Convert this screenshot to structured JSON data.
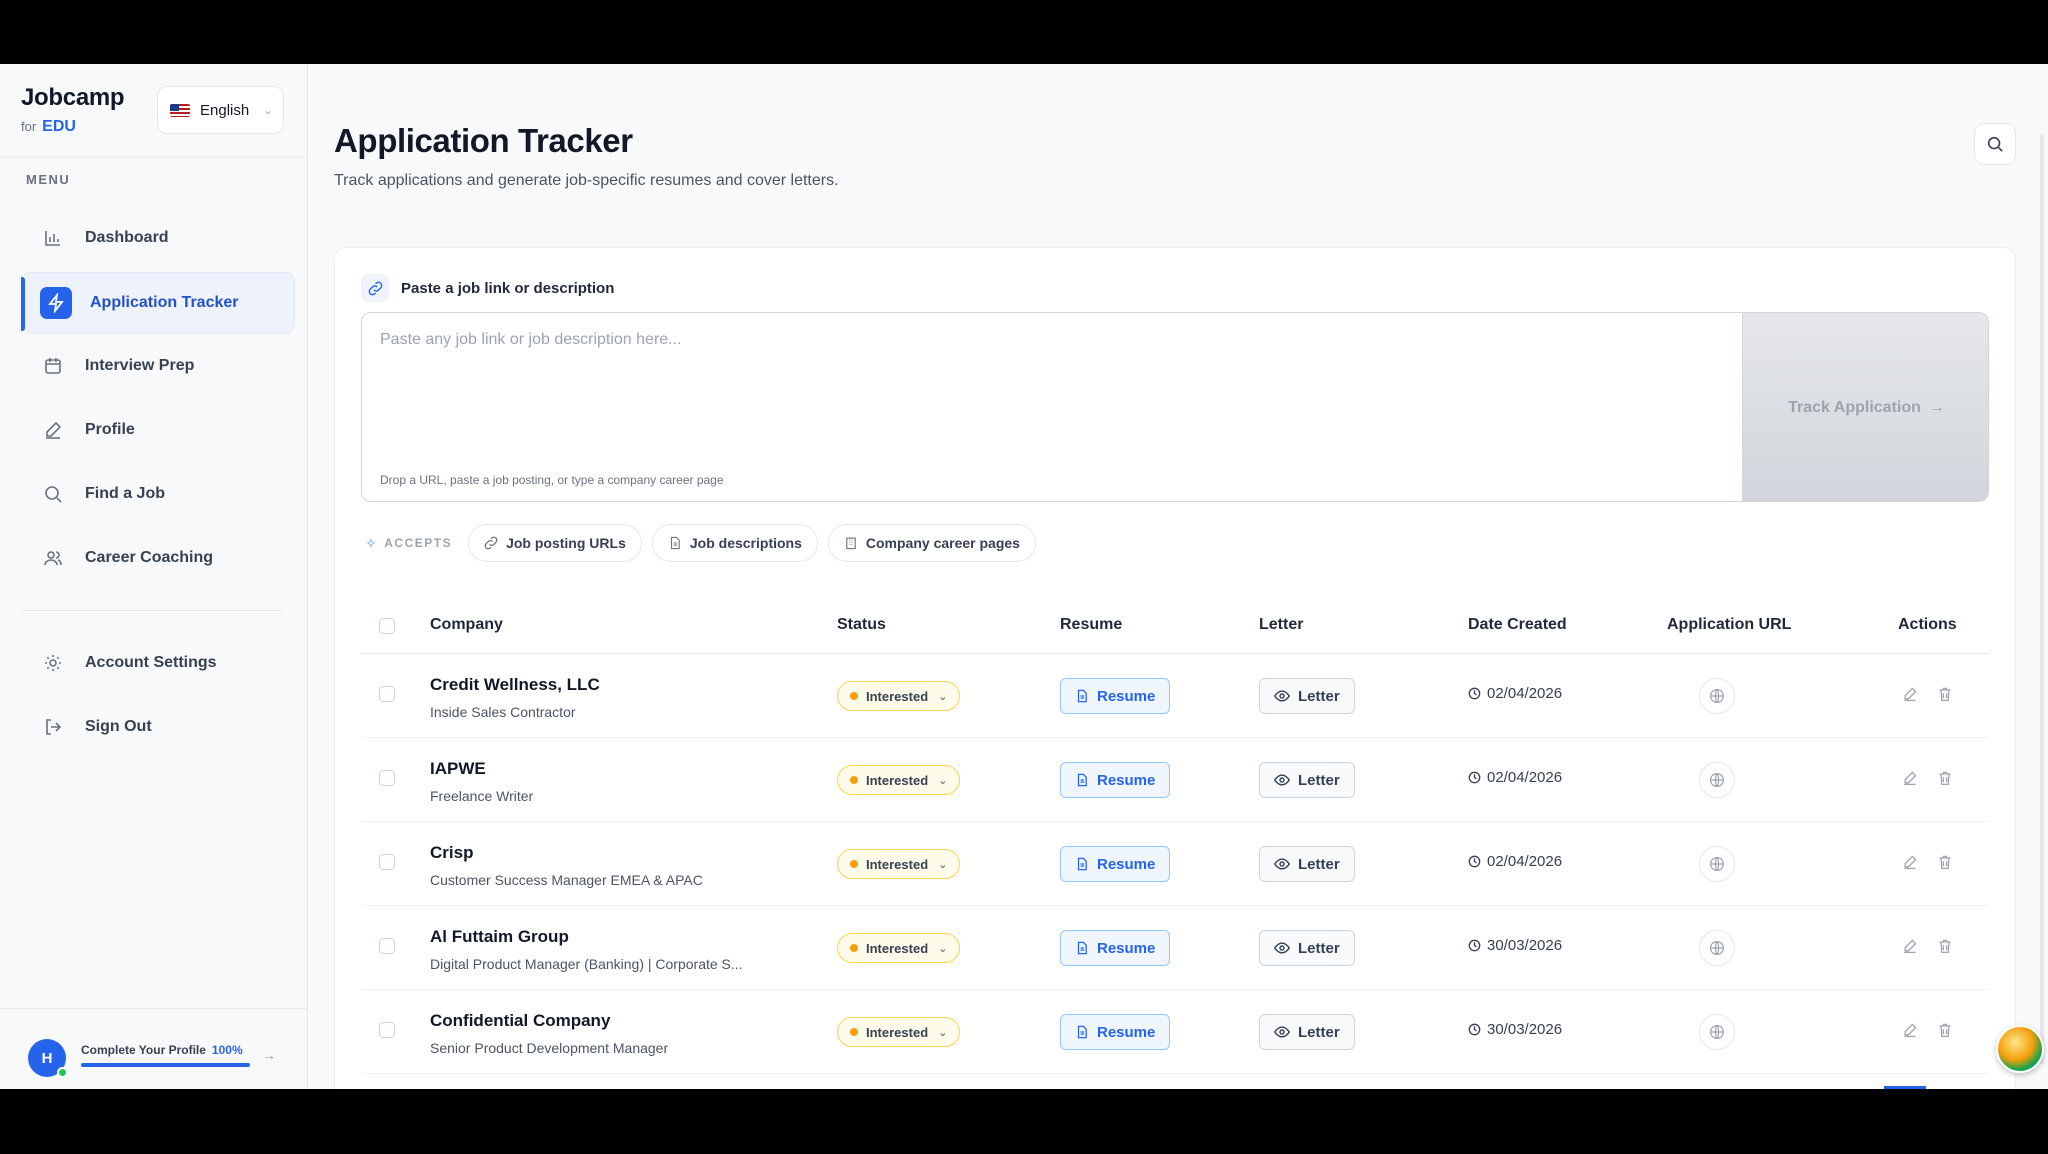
{
  "brand": {
    "name": "Jobcamp",
    "for_label": "for",
    "edu_label": "EDU"
  },
  "language": {
    "label": "English"
  },
  "menu_title": "MENU",
  "nav": [
    {
      "label": "Dashboard",
      "icon": "bar-chart-icon"
    },
    {
      "label": "Application Tracker",
      "icon": "lightning-icon",
      "active": true
    },
    {
      "label": "Interview Prep",
      "icon": "calendar-icon"
    },
    {
      "label": "Profile",
      "icon": "pencil-icon"
    },
    {
      "label": "Find a Job",
      "icon": "search-icon"
    },
    {
      "label": "Career Coaching",
      "icon": "users-icon"
    }
  ],
  "nav_secondary": [
    {
      "label": "Account Settings",
      "icon": "gear-icon"
    },
    {
      "label": "Sign Out",
      "icon": "sign-out-icon"
    }
  ],
  "profile": {
    "initial": "H",
    "label": "Complete Your Profile",
    "percent_text": "100%",
    "progress": 1.0
  },
  "page": {
    "title": "Application Tracker",
    "subtitle": "Track applications and generate job-specific resumes and cover letters."
  },
  "paste": {
    "heading": "Paste a job link or description",
    "placeholder": "Paste any job link or job description here...",
    "value": "",
    "hint": "Drop a URL, paste a job posting, or type a company career page",
    "button_label": "Track Application"
  },
  "accepts": {
    "label": "ACCEPTS",
    "chips": [
      "Job posting URLs",
      "Job descriptions",
      "Company career pages"
    ]
  },
  "table": {
    "headers": {
      "company": "Company",
      "status": "Status",
      "resume": "Resume",
      "letter": "Letter",
      "date": "Date Created",
      "url": "Application URL",
      "actions": "Actions"
    },
    "rows": [
      {
        "company": "Credit Wellness, LLC",
        "role": "Inside Sales Contractor",
        "status": "Interested",
        "resume": "Resume",
        "letter": "Letter",
        "date": "02/04/2026"
      },
      {
        "company": "IAPWE",
        "role": "Freelance Writer",
        "status": "Interested",
        "resume": "Resume",
        "letter": "Letter",
        "date": "02/04/2026"
      },
      {
        "company": "Crisp",
        "role": "Customer Success Manager EMEA & APAC",
        "status": "Interested",
        "resume": "Resume",
        "letter": "Letter",
        "date": "02/04/2026"
      },
      {
        "company": "Al Futtaim Group",
        "role": "Digital Product Manager (Banking) | Corporate S...",
        "status": "Interested",
        "resume": "Resume",
        "letter": "Letter",
        "date": "30/03/2026"
      },
      {
        "company": "Confidential Company",
        "role": "Senior Product Development Manager",
        "status": "Interested",
        "resume": "Resume",
        "letter": "Letter",
        "date": "30/03/2026"
      }
    ]
  },
  "colors": {
    "accent": "#2563eb",
    "status_dot": "#f59e0b",
    "status_bg": "#fffbeb"
  }
}
